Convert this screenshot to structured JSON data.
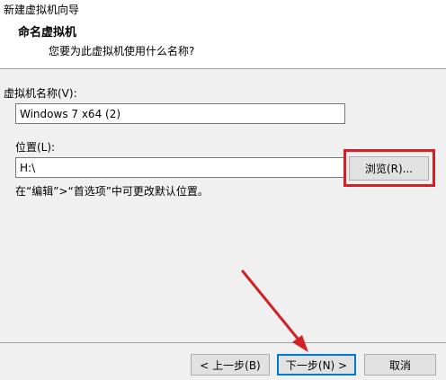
{
  "window": {
    "title": "新建虚拟机向导"
  },
  "header": {
    "title": "命名虚拟机",
    "subtitle": "您要为此虚拟机使用什么名称?"
  },
  "form": {
    "name_label": "虚拟机名称(V):",
    "name_value": "Windows 7 x64 (2)",
    "location_label": "位置(L):",
    "location_value": "H:\\",
    "browse_label": "浏览(R)...",
    "hint": "在“编辑”>“首选项”中可更改默认位置。"
  },
  "footer": {
    "back_label": "< 上一步(B)",
    "next_label": "下一步(N) >",
    "cancel_label": "取消"
  },
  "colors": {
    "highlight": "#d42024",
    "arrow": "#d42024",
    "default_button_border": "#0078d7"
  }
}
